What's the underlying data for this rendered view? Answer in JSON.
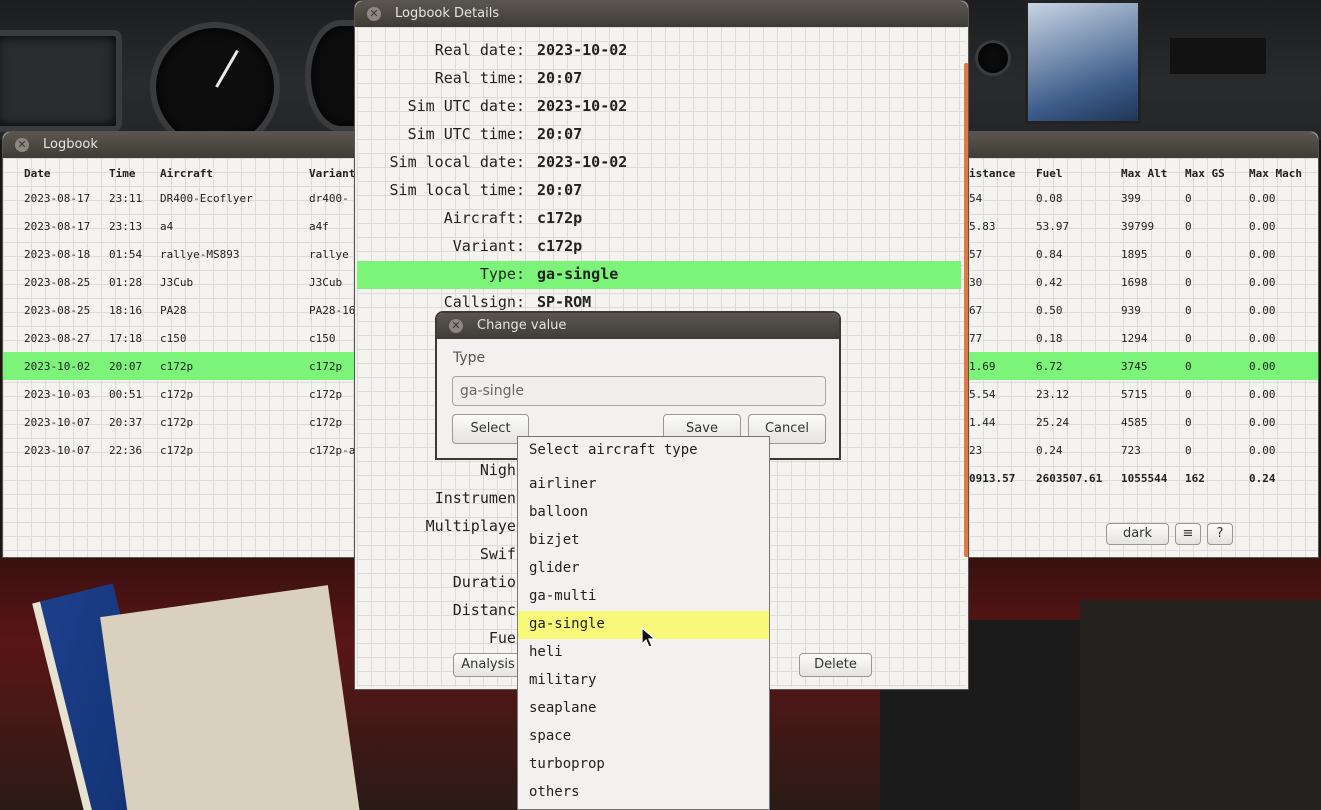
{
  "logbook": {
    "title": "Logbook",
    "columns_left": [
      "Date",
      "Time",
      "Aircraft",
      "Variant"
    ],
    "columns_right": [
      "istance",
      "Fuel",
      "Max Alt",
      "Max GS",
      "Max Mach"
    ],
    "rows": [
      {
        "date": "2023-08-17",
        "time": "23:11",
        "aircraft": "DR400-Ecoflyer",
        "variant": "dr400-",
        "distance": "54",
        "fuel": "0.08",
        "max_alt": "399",
        "max_gs": "0",
        "max_mach": "0.00"
      },
      {
        "date": "2023-08-17",
        "time": "23:13",
        "aircraft": "a4",
        "variant": "a4f",
        "distance": "5.83",
        "fuel": "53.97",
        "max_alt": "39799",
        "max_gs": "0",
        "max_mach": "0.00"
      },
      {
        "date": "2023-08-18",
        "time": "01:54",
        "aircraft": "rallye-MS893",
        "variant": "rallye",
        "distance": "57",
        "fuel": "0.84",
        "max_alt": "1895",
        "max_gs": "0",
        "max_mach": "0.00"
      },
      {
        "date": "2023-08-25",
        "time": "01:28",
        "aircraft": "J3Cub",
        "variant": "J3Cub",
        "distance": "30",
        "fuel": "0.42",
        "max_alt": "1698",
        "max_gs": "0",
        "max_mach": "0.00"
      },
      {
        "date": "2023-08-25",
        "time": "18:16",
        "aircraft": "PA28",
        "variant": "PA28-16",
        "distance": "67",
        "fuel": "0.50",
        "max_alt": "939",
        "max_gs": "0",
        "max_mach": "0.00"
      },
      {
        "date": "2023-08-27",
        "time": "17:18",
        "aircraft": "c150",
        "variant": "c150",
        "distance": "77",
        "fuel": "0.18",
        "max_alt": "1294",
        "max_gs": "0",
        "max_mach": "0.00"
      },
      {
        "date": "2023-10-02",
        "time": "20:07",
        "aircraft": "c172p",
        "variant": "c172p",
        "distance": "1.69",
        "fuel": "6.72",
        "max_alt": "3745",
        "max_gs": "0",
        "max_mach": "0.00"
      },
      {
        "date": "2023-10-03",
        "time": "00:51",
        "aircraft": "c172p",
        "variant": "c172p",
        "distance": "5.54",
        "fuel": "23.12",
        "max_alt": "5715",
        "max_gs": "0",
        "max_mach": "0.00"
      },
      {
        "date": "2023-10-07",
        "time": "20:37",
        "aircraft": "c172p",
        "variant": "c172p",
        "distance": "1.44",
        "fuel": "25.24",
        "max_alt": "4585",
        "max_gs": "0",
        "max_mach": "0.00"
      },
      {
        "date": "2023-10-07",
        "time": "22:36",
        "aircraft": "c172p",
        "variant": "c172p-a",
        "distance": "23",
        "fuel": "0.24",
        "max_alt": "723",
        "max_gs": "0",
        "max_mach": "0.00"
      }
    ],
    "selected_row": 6,
    "totals": {
      "distance": "0913.57",
      "fuel": "2603507.61",
      "max_alt": "1055544",
      "max_gs": "162",
      "max_mach": "0.24"
    },
    "buttons": {
      "dark": "dark",
      "menu": "≡",
      "help": "?"
    }
  },
  "details": {
    "title": "Logbook Details",
    "rows": [
      {
        "label": "Real date:",
        "value": "2023-10-02"
      },
      {
        "label": "Real time:",
        "value": "20:07"
      },
      {
        "label": "Sim UTC date:",
        "value": "2023-10-02"
      },
      {
        "label": "Sim UTC time:",
        "value": "20:07"
      },
      {
        "label": "Sim local date:",
        "value": "2023-10-02"
      },
      {
        "label": "Sim local time:",
        "value": "20:07"
      },
      {
        "label": "Aircraft:",
        "value": "c172p"
      },
      {
        "label": "Variant:",
        "value": "c172p"
      },
      {
        "label": "Type:",
        "value": "ga-single"
      },
      {
        "label": "Callsign:",
        "value": "SP-ROM"
      }
    ],
    "highlighted_row": 8,
    "lower_labels": [
      "Night",
      "Instrument",
      "Multiplayer",
      "Swift",
      "Duration",
      "Distance",
      "Fuel"
    ],
    "buttons": {
      "analysis": "Analysis",
      "delete": "Delete"
    }
  },
  "change_value": {
    "title": "Change value",
    "field_label": "Type",
    "input_value": "ga-single",
    "buttons": {
      "select": "Select",
      "save": "Save",
      "cancel": "Cancel"
    }
  },
  "dropdown": {
    "title": "Select aircraft type",
    "items": [
      "airliner",
      "balloon",
      "bizjet",
      "glider",
      "ga-multi",
      "ga-single",
      "heli",
      "military",
      "seaplane",
      "space",
      "turboprop",
      "others"
    ],
    "selected": "ga-single"
  },
  "colors": {
    "selection_green": "#7cf47a",
    "selection_yellow": "#f8f87a",
    "scrollbar_orange": "#e07a45",
    "titlebar": "#4a4540"
  }
}
